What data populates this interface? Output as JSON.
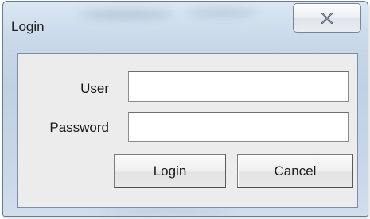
{
  "window": {
    "title": "Login",
    "close_icon": "close-x-icon"
  },
  "form": {
    "user_label": "User",
    "user_value": "",
    "password_label": "Password",
    "password_value": ""
  },
  "buttons": {
    "login_label": "Login",
    "cancel_label": "Cancel"
  },
  "colors": {
    "frame": "#c9d9ea",
    "client": "#ececec"
  }
}
